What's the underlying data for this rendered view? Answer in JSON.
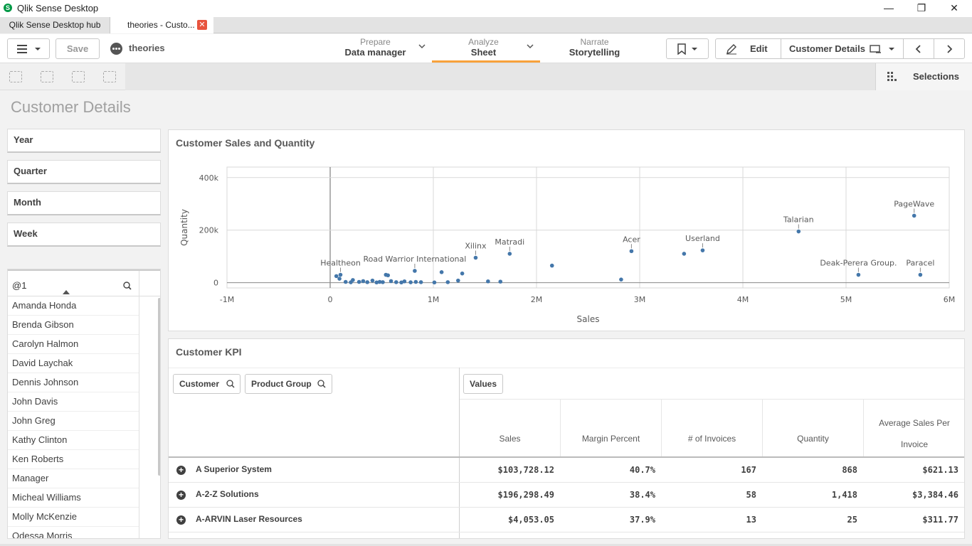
{
  "window": {
    "app_title": "Qlik Sense Desktop",
    "minimize": "—",
    "restore": "❐",
    "close": "✕"
  },
  "tabs": {
    "hub": "Qlik Sense Desktop hub",
    "active": "theories - Custo...",
    "close": "✕"
  },
  "toolbar": {
    "save": "Save",
    "app_name": "theories",
    "prepare_sub": "Prepare",
    "prepare_main": "Data manager",
    "analyze_sub": "Analyze",
    "analyze_main": "Sheet",
    "narrate_sub": "Narrate",
    "narrate_main": "Storytelling",
    "edit": "Edit",
    "sheet_name": "Customer Details"
  },
  "subbar": {
    "selections": "Selections"
  },
  "sheet": {
    "title": "Customer Details"
  },
  "filters": [
    "Year",
    "Quarter",
    "Month",
    "Week"
  ],
  "listbox": {
    "search_value": "@1",
    "items": [
      "Amanda Honda",
      "Brenda Gibson",
      "Carolyn Halmon",
      "David Laychak",
      "Dennis Johnson",
      "John Davis",
      "John Greg",
      "Kathy Clinton",
      "Ken Roberts",
      "Manager",
      "Micheal Williams",
      "Molly McKenzie",
      "Odessa Morris"
    ]
  },
  "scatter": {
    "title": "Customer Sales and Quantity"
  },
  "chart_data": {
    "type": "scatter",
    "title": "Customer Sales and Quantity",
    "xlabel": "Sales",
    "ylabel": "Quantity",
    "xlim": [
      -1000000,
      6000000
    ],
    "ylim": [
      -20000,
      440000
    ],
    "x_ticks": [
      -1000000,
      0,
      1000000,
      2000000,
      3000000,
      4000000,
      5000000,
      6000000
    ],
    "x_tick_labels": [
      "-1M",
      "0",
      "1M",
      "2M",
      "3M",
      "4M",
      "5M",
      "6M"
    ],
    "y_ticks": [
      0,
      200000,
      400000
    ],
    "y_tick_labels": [
      "0",
      "200k",
      "400k"
    ],
    "grid": true,
    "labeled_points": [
      {
        "label": "Healtheon",
        "x": 100000,
        "y": 30000
      },
      {
        "label": "Road Warrior International",
        "x": 820000,
        "y": 45000
      },
      {
        "label": "Xilinx",
        "x": 1410000,
        "y": 95000
      },
      {
        "label": "Matradi",
        "x": 1740000,
        "y": 110000
      },
      {
        "label": "Acer",
        "x": 2920000,
        "y": 120000
      },
      {
        "label": "Userland",
        "x": 3610000,
        "y": 123000
      },
      {
        "label": "Talarian",
        "x": 4540000,
        "y": 195000
      },
      {
        "label": "PageWave",
        "x": 5660000,
        "y": 255000
      },
      {
        "label": "Deak-Perera Group.",
        "x": 5120000,
        "y": 30000
      },
      {
        "label": "Paracel",
        "x": 5720000,
        "y": 30000
      }
    ],
    "points": [
      {
        "x": 60000,
        "y": 25000
      },
      {
        "x": 90000,
        "y": 15000
      },
      {
        "x": 150000,
        "y": 3000
      },
      {
        "x": 200000,
        "y": 1500
      },
      {
        "x": 220000,
        "y": 10000
      },
      {
        "x": 280000,
        "y": 3000
      },
      {
        "x": 320000,
        "y": 6000
      },
      {
        "x": 360000,
        "y": 2000
      },
      {
        "x": 410000,
        "y": 8000
      },
      {
        "x": 450000,
        "y": 1000
      },
      {
        "x": 480000,
        "y": 3000
      },
      {
        "x": 510000,
        "y": 2000
      },
      {
        "x": 540000,
        "y": 30000
      },
      {
        "x": 560000,
        "y": 28000
      },
      {
        "x": 590000,
        "y": 6000
      },
      {
        "x": 640000,
        "y": 2000
      },
      {
        "x": 690000,
        "y": 1000
      },
      {
        "x": 720000,
        "y": 5000
      },
      {
        "x": 780000,
        "y": 1500
      },
      {
        "x": 830000,
        "y": 3000
      },
      {
        "x": 880000,
        "y": 2000
      },
      {
        "x": 1010000,
        "y": 1000
      },
      {
        "x": 1080000,
        "y": 40000
      },
      {
        "x": 1140000,
        "y": 2000
      },
      {
        "x": 1240000,
        "y": 8000
      },
      {
        "x": 1280000,
        "y": 35000
      },
      {
        "x": 1530000,
        "y": 5000
      },
      {
        "x": 1650000,
        "y": 4000
      },
      {
        "x": 2150000,
        "y": 65000
      },
      {
        "x": 2820000,
        "y": 12000
      },
      {
        "x": 3430000,
        "y": 110000
      }
    ]
  },
  "kpi": {
    "title": "Customer KPI",
    "dim_customer": "Customer",
    "dim_product_group": "Product Group",
    "values_label": "Values",
    "columns": [
      "Sales",
      "Margin Percent",
      "# of Invoices",
      "Quantity",
      "Average Sales Per Invoice"
    ],
    "rows": [
      {
        "name": "A Superior System",
        "cells": [
          "$103,728.12",
          "40.7%",
          "167",
          "868",
          "$621.13"
        ]
      },
      {
        "name": "A-2-Z Solutions",
        "cells": [
          "$196,298.49",
          "38.4%",
          "58",
          "1,418",
          "$3,384.46"
        ]
      },
      {
        "name": "A-ARVIN Laser Resources",
        "cells": [
          "$4,053.05",
          "37.9%",
          "13",
          "25",
          "$311.77"
        ]
      }
    ]
  }
}
